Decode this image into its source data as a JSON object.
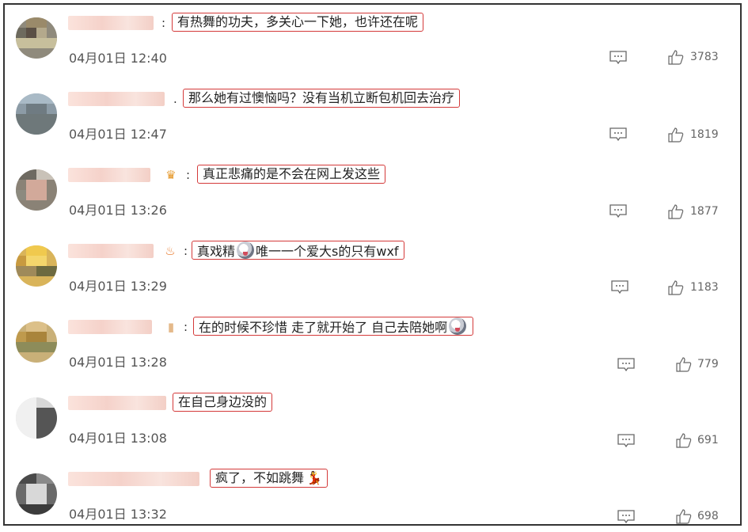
{
  "comments": [
    {
      "text": "有热舞的功夫，多关心一下她，也许还在呢",
      "time": "04月01日 12:40",
      "likes": "3783",
      "sep": ":"
    },
    {
      "text": "那么她有过懊恼吗？没有当机立断包机回去治疗",
      "time": "04月01日 12:47",
      "likes": "1819",
      "sep": "."
    },
    {
      "text": "真正悲痛的是不会在网上发这些",
      "time": "04月01日 13:26",
      "likes": "1877",
      "sep": ":"
    },
    {
      "text_a": "真戏精",
      "text_b": "唯一一个爱大s的只有wxf",
      "time": "04月01日 13:29",
      "likes": "1183",
      "sep": ":"
    },
    {
      "text": "在的时候不珍惜 走了就开始了 自己去陪她啊",
      "time": "04月01日 13:28",
      "likes": "779",
      "sep": ":"
    },
    {
      "text": "在自己身边没的",
      "time": "04月01日 13:08",
      "likes": "691",
      "sep": ""
    },
    {
      "text": "疯了，不如跳舞",
      "time": "04月01日 13:32",
      "likes": "698",
      "sep": ""
    }
  ],
  "icons": {
    "reply": "comment-icon",
    "like": "thumbs-up-icon"
  }
}
